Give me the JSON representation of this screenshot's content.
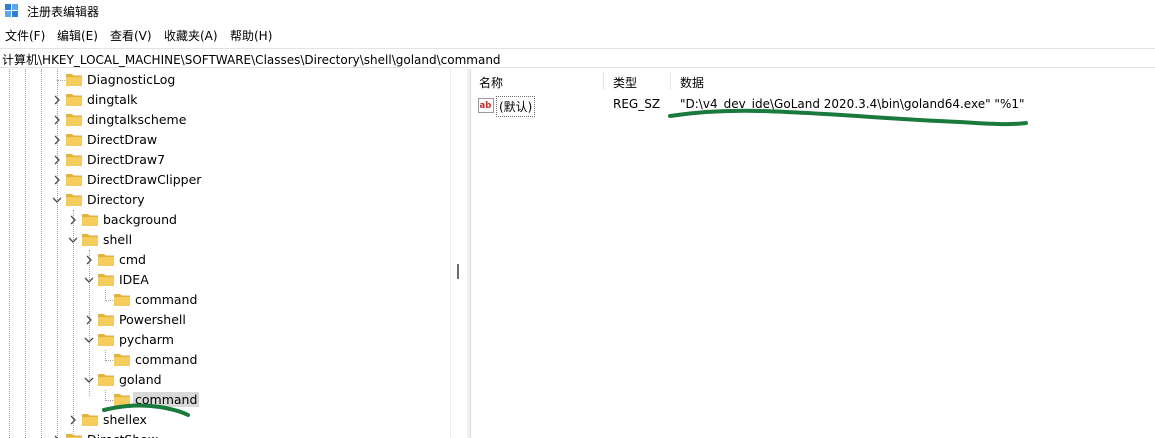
{
  "window": {
    "title": "注册表编辑器"
  },
  "menu": [
    "文件(F)",
    "编辑(E)",
    "查看(V)",
    "收藏夹(A)",
    "帮助(H)"
  ],
  "address": "计算机\\HKEY_LOCAL_MACHINE\\SOFTWARE\\Classes\\Directory\\shell\\goland\\command",
  "tree": [
    {
      "label": "DiagnosticLog",
      "expander": ""
    },
    {
      "label": "dingtalk",
      "expander": "collapsed"
    },
    {
      "label": "dingtalkscheme",
      "expander": "collapsed"
    },
    {
      "label": "DirectDraw",
      "expander": "collapsed"
    },
    {
      "label": "DirectDraw7",
      "expander": "collapsed"
    },
    {
      "label": "DirectDrawClipper",
      "expander": "collapsed"
    },
    {
      "label": "Directory",
      "expander": "expanded"
    },
    {
      "label": "background",
      "expander": "collapsed"
    },
    {
      "label": "shell",
      "expander": "expanded"
    },
    {
      "label": "cmd",
      "expander": "collapsed"
    },
    {
      "label": "IDEA",
      "expander": "expanded"
    },
    {
      "label": "command",
      "expander": ""
    },
    {
      "label": "Powershell",
      "expander": "collapsed"
    },
    {
      "label": "pycharm",
      "expander": "expanded"
    },
    {
      "label": "command",
      "expander": ""
    },
    {
      "label": "goland",
      "expander": "expanded"
    },
    {
      "label": "command",
      "expander": "",
      "selected": true
    },
    {
      "label": "shellex",
      "expander": "collapsed"
    },
    {
      "label": "DirectShow",
      "expander": "collapsed"
    }
  ],
  "list": {
    "headers": {
      "name": "名称",
      "type": "类型",
      "data": "数据"
    },
    "values": [
      {
        "icon": "string-value-icon",
        "name": "(默认)",
        "type": "REG_SZ",
        "data": "\"D:\\v4_dev_ide\\GoLand 2020.3.4\\bin\\goland64.exe\" \"%1\""
      }
    ]
  },
  "colors": {
    "folder": "#f6cc5c",
    "folder_dark": "#e2b33f",
    "selection": "#d9d9d9",
    "annotation": "#1a7a3c"
  }
}
